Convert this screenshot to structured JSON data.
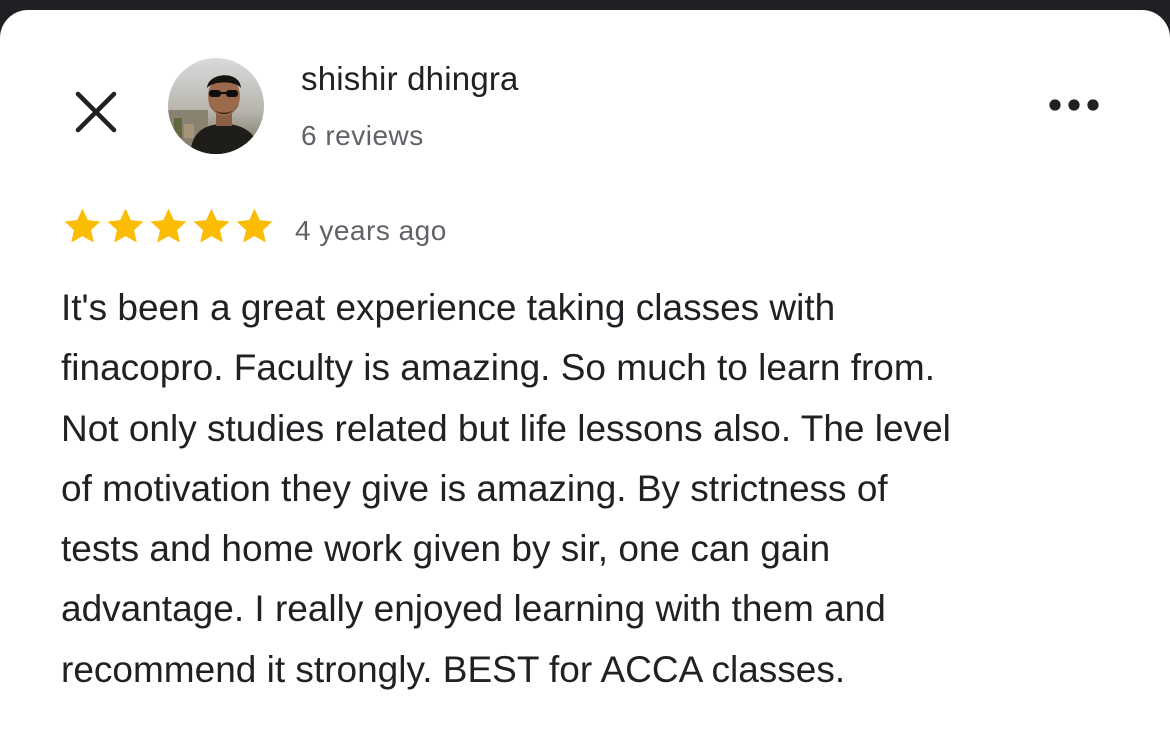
{
  "reviewer": {
    "name": "shishir dhingra",
    "review_count": "6 reviews"
  },
  "review": {
    "rating": 5,
    "max_rating": 5,
    "time_ago": "4 years ago",
    "text_lines": [
      "It's been a great experience taking classes with",
      "finacopro. Faculty is amazing. So much to learn from.",
      "Not only studies related but life lessons also. The level",
      "of motivation they give is amazing. By strictness of",
      "tests and home work given by sir, one can gain",
      "advantage. I really enjoyed learning with them and",
      "recommend it strongly. BEST for ACCA classes."
    ]
  },
  "icons": {
    "close": "close-icon",
    "more": "more-options-icon",
    "star": "star-icon"
  },
  "colors": {
    "star": "#fbbc04",
    "text": "#202124",
    "secondary_text": "#5f6368",
    "background": "#ffffff"
  }
}
